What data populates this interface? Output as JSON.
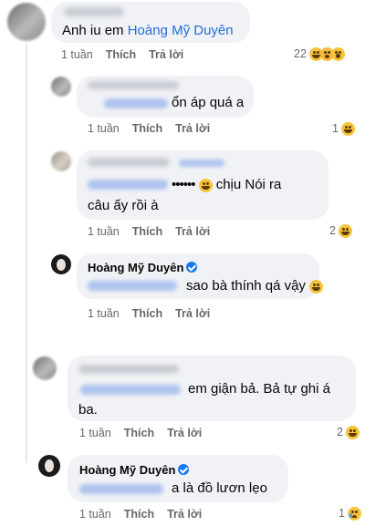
{
  "comments": [
    {
      "text_parts": [
        "Anh iu em ",
        "Hoàng Mỹ Duyên"
      ],
      "time": "1 tuần",
      "like": "Thích",
      "reply": "Trả lời",
      "reaction_count": "22",
      "reaction_icons": [
        "laugh-emoji-icon",
        "wow-emoji-icon",
        "surprised-emoji-icon"
      ]
    },
    {
      "text": "ổn áp quá a",
      "time": "1 tuần",
      "like": "Thích",
      "reply": "Trả lời",
      "reaction_count": "1"
    },
    {
      "line1": "chịu Nói ra",
      "line2": "câu ấy rồi  à",
      "time": "1 tuần",
      "like": "Thích",
      "reply": "Trả lời",
      "reaction_count": "2"
    },
    {
      "author": "Hoàng Mỹ Duyên",
      "text": "sao bà thính qá vậy",
      "time": "1 tuần",
      "like": "Thích",
      "reply": "Trả lời"
    },
    {
      "line1": "em giận bả. Bả tự ghi á",
      "line2": "ba.",
      "time": "1 tuần",
      "like": "Thích",
      "reply": "Trả lời",
      "reaction_count": "2"
    },
    {
      "author": "Hoàng Mỹ Duyên",
      "text": "a là đồ lươn lẹo",
      "time": "1 tuần",
      "like": "Thích",
      "reply": "Trả lời",
      "reaction_count": "1"
    }
  ],
  "colors": {
    "bubble": "#f0f2f5",
    "link": "#216fdb",
    "meta": "#65676b",
    "verified": "#1877f2"
  }
}
